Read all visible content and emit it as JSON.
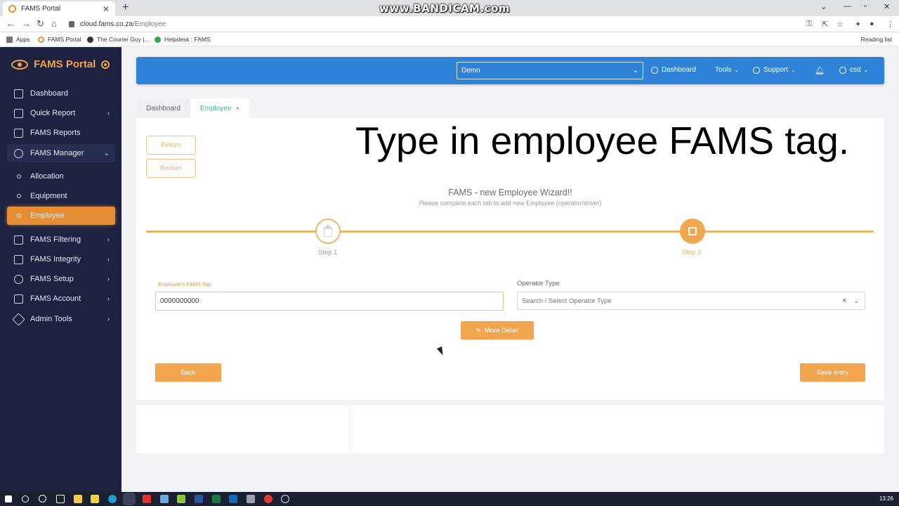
{
  "browser": {
    "tab_title": "FAMS Portal",
    "tab_close": "✕",
    "new_tab": "+",
    "url_domain": "cloud.fams.co.za",
    "url_path": "/Employee",
    "watermark": "www.BANDICAM.com",
    "bookmarks": [
      "Apps",
      "FAMS Portal",
      "The Courier Guy |...",
      "Helpdesk : FAMS"
    ],
    "reading_list": "Reading list"
  },
  "sidebar": {
    "brand": "FAMS Portal",
    "items": [
      {
        "label": "Dashboard"
      },
      {
        "label": "Quick Report"
      },
      {
        "label": "FAMS Reports"
      },
      {
        "label": "FAMS Manager"
      },
      {
        "label": "FAMS Filtering"
      },
      {
        "label": "FAMS Integrity"
      },
      {
        "label": "FAMS Setup"
      },
      {
        "label": "FAMS Account"
      },
      {
        "label": "Admin Tools"
      }
    ],
    "sub_items": [
      {
        "label": "Allocation"
      },
      {
        "label": "Equipment"
      },
      {
        "label": "Employee"
      }
    ]
  },
  "topbar": {
    "company_select": "Demo",
    "dashboard": "Dashboard",
    "tools": "Tools",
    "support": "Support",
    "user": "csd"
  },
  "page_tabs": [
    {
      "label": "Dashboard"
    },
    {
      "label": "Employee",
      "close": "×"
    }
  ],
  "actions": {
    "return": "Return",
    "restart": "Restart"
  },
  "overlay_caption": "Type in employee FAMS tag.",
  "wizard": {
    "title": "FAMS - new Employee Wizard!!",
    "subtitle": "Please complete each tab to add new Employee (operator/driver)",
    "step1": "Step 1",
    "step2": "Step 2"
  },
  "form": {
    "tag_label": "Employee's FAMS Tag",
    "tag_value": "0000000000",
    "operator_label": "Operator Type",
    "operator_placeholder": "Search / Select Operator Type",
    "more_detail": "More Detail",
    "back": "Back",
    "save_entry": "Save entry"
  },
  "taskbar": {
    "clock": "13:26"
  },
  "colors": {
    "accent": "#f2a54f",
    "sidebar_bg": "#1d2240",
    "topbar_bg": "#2e83d8",
    "active_tab_text": "#48b68c"
  }
}
